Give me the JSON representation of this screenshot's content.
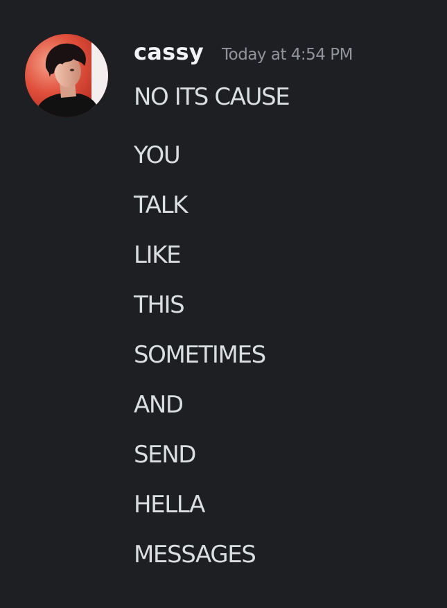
{
  "message": {
    "author": "cassy",
    "timestamp": "Today at 4:54 PM",
    "avatar_icon": "user-avatar-photo",
    "lines": [
      "NO ITS CAUSE",
      "YOU",
      "TALK",
      "LIKE",
      "THIS",
      "SOMETIMES",
      "AND",
      "SEND",
      "HELLA",
      "MESSAGES"
    ]
  },
  "colors": {
    "background": "#1e1f23",
    "username": "#f2f3f5",
    "timestamp": "#92949b",
    "message_text": "#dbdee1"
  }
}
